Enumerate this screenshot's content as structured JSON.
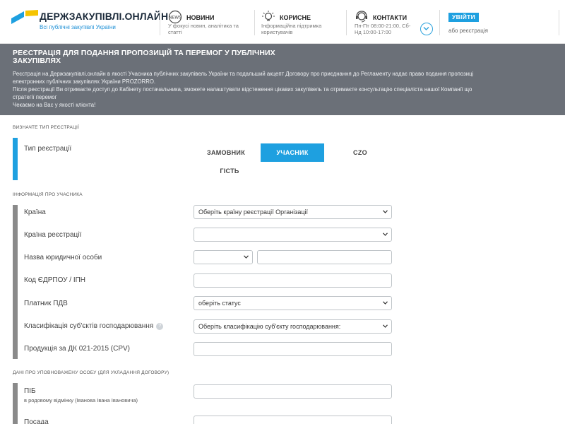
{
  "header": {
    "logo_title": "ДЕРЖЗАКУПІВЛІ.ОНЛАЙН",
    "logo_subtitle": "Всі публічні закупівлі України",
    "news_title": "НОВИНИ",
    "news_desc": "У фокусі новин, аналітика та статті",
    "useful_title": "КОРИСНЕ",
    "useful_desc": "Інформаційна підтримка користувачів",
    "contacts_title": "КОНТАКТИ",
    "hours": "Пн-Пт 08:00-21:00, Сб-Нд 10:00-17:00",
    "login_label": "УВІЙТИ",
    "register_label": "або реєстрація",
    "colors": {
      "accent": "#1ea0e0",
      "logo_yellow": "#f5c400"
    }
  },
  "banner": {
    "title": "РЕЄСТРАЦІЯ ДЛЯ ПОДАННЯ ПРОПОЗИЦІЙ ТА ПЕРЕМОГ У ПУБЛІЧНИХ ЗАКУПІВЛЯХ",
    "line1": "Реєстрація на Держзакупівлі.онлайн в якості Учасника публічних закупівель України та подальший акцепт Договору про приєднання до Регламенту надає право подання пропозиці",
    "line2": "електронних публічних закупівлях України PROZORRO.",
    "line3": "Після реєстрації Ви отримаєте доступ до Кабінету постачальника, зможете налаштувати відстеження цікавих закупівель та отримаєте консультацію спеціаліста нашої Компанії що",
    "line4": "стратегії перемог",
    "line5": "Чекаємо на Вас у якості клієнта!"
  },
  "form": {
    "section_type": "ВИЗНАЧТЕ ТИП РЕЄСТРАЦІЇ",
    "type_label": "Тип реєстрації",
    "type_options": [
      "ЗАМОВНИК",
      "УЧАСНИК",
      "CZO",
      "ГІСТЬ"
    ],
    "selected_type": "УЧАСНИК",
    "section_participant": "ІНФОРМАЦІЯ ПРО УЧАСНИКА",
    "country_label": "Країна",
    "country_value": "Оберіть країну реєстрації Організації",
    "reg_country_label": "Країна реєстрації",
    "reg_country_value": "",
    "legal_name_label": "Назва юридичної особи",
    "legal_form_value": "",
    "legal_name_value": "",
    "edrpou_label": "Код ЄДРПОУ / ІПН",
    "edrpou_value": "",
    "vat_label": "Платник ПДВ",
    "vat_value": "оберіть статус",
    "classification_label": "Класифікація суб'єктів господарювання",
    "classification_value": "Оберіть класифікацію суб'єкту господарювання:",
    "cpv_label": "Продукція за ДК 021-2015 (CPV)",
    "cpv_value": "",
    "section_authorized": "ДАНІ ПРО УПОВНОВАЖЕНУ ОСОБУ (ДЛЯ УКЛАДАННЯ ДОГОВОРУ)",
    "pib_label": "ПІБ",
    "pib_hint": "в родовому відмінку (Іванова Івана Івановича)",
    "pib_value": "",
    "position_label": "Посада",
    "position_value": ""
  }
}
